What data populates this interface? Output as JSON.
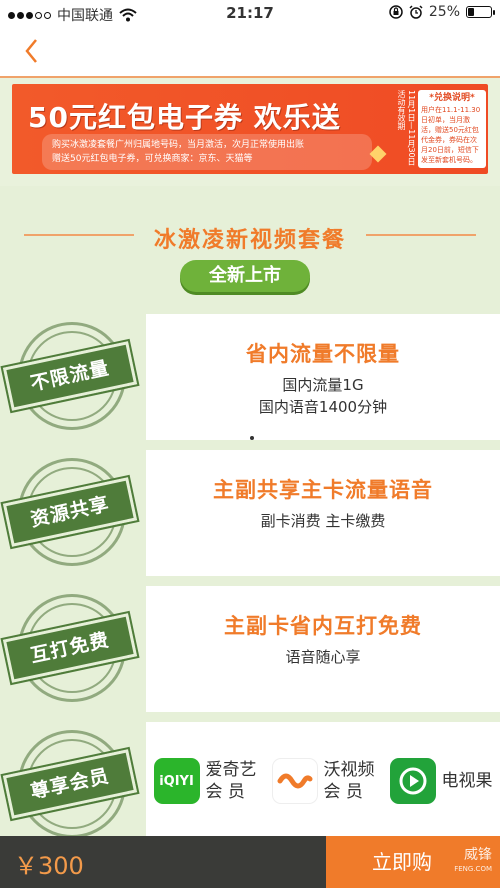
{
  "status_bar": {
    "carrier": "中国联通",
    "time": "21:17",
    "battery": "25%",
    "battery_level": 0.25
  },
  "banner": {
    "title": "50元红包电子券 欢乐送",
    "desc_line1": "购买冰激凌套餐广州归属地号码，当月激活，次月正常使用出账",
    "desc_line2": "赠送50元红包电子券，可兑换商家：京东、天猫等",
    "date": "11月1日—11月30日  活动有效期",
    "redeem_title": "*兑换说明*",
    "redeem_text": "用户在11.1-11.30日初单，当月激活，赠送50元红包代金券，券码在次月20日前，短信下发至新套机号码。"
  },
  "section": {
    "title": "冰激凌新视频套餐",
    "badge": "全新上市"
  },
  "features": [
    {
      "stamp": "不限流量",
      "main": "省内流量不限量",
      "sub1": "国内流量1G",
      "sub2": "国内语音1400分钟"
    },
    {
      "stamp": "资源共享",
      "main": "主副共享主卡流量语音",
      "sub1": "副卡消费 主卡缴费"
    },
    {
      "stamp": "互打免费",
      "main": "主副卡省内互打免费",
      "sub1": "语音随心享"
    },
    {
      "stamp": "尊享会员"
    }
  ],
  "members": [
    {
      "logo": "iQIYI",
      "name1": "爱奇艺",
      "name2": "会 员"
    },
    {
      "logo": "wo",
      "name1": "沃视频",
      "name2": "会 员"
    },
    {
      "logo": "tv",
      "name1": "电视果",
      "name2": ""
    }
  ],
  "footer": {
    "price": "￥300",
    "buy_label": "立即购",
    "watermark": "威锋",
    "watermark_sub": "FENG.COM"
  },
  "icons": {
    "back": "chevron-left-icon",
    "wifi": "wifi-icon",
    "lock": "orientation-lock-icon",
    "alarm": "alarm-icon"
  },
  "colors": {
    "accent": "#f07b2a",
    "green": "#6fb23a",
    "banner": "#f25a2a"
  }
}
